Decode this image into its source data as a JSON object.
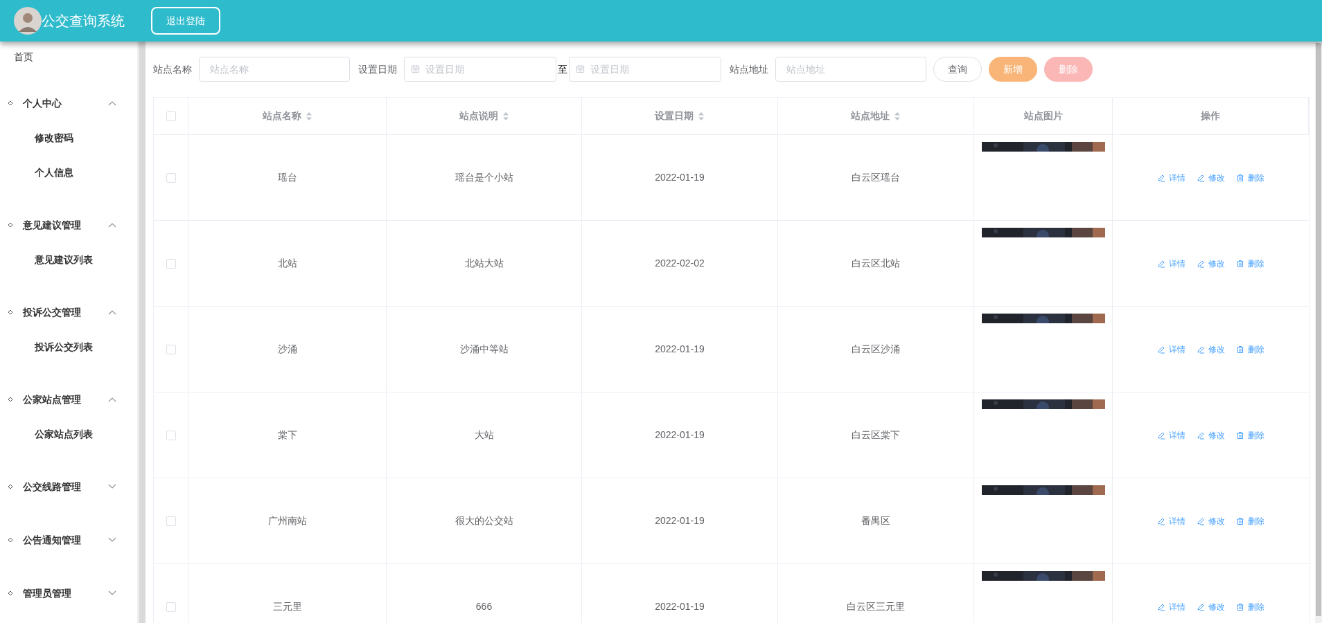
{
  "header": {
    "title": "公交查询系统",
    "logout": "退出登陆"
  },
  "sidebar": {
    "home": "首页",
    "groups": [
      {
        "label": "个人中心",
        "expanded": true,
        "children": [
          {
            "label": "修改密码"
          },
          {
            "label": "个人信息"
          }
        ]
      },
      {
        "label": "意见建议管理",
        "expanded": true,
        "children": [
          {
            "label": "意见建议列表"
          }
        ]
      },
      {
        "label": "投诉公交管理",
        "expanded": true,
        "children": [
          {
            "label": "投诉公交列表"
          }
        ]
      },
      {
        "label": "公家站点管理",
        "expanded": true,
        "children": [
          {
            "label": "公家站点列表"
          }
        ]
      },
      {
        "label": "公交线路管理",
        "expanded": false
      },
      {
        "label": "公告通知管理",
        "expanded": false
      },
      {
        "label": "管理员管理",
        "expanded": false
      }
    ]
  },
  "filters": {
    "name": {
      "label": "站点名称",
      "placeholder": "站点名称"
    },
    "date": {
      "label": "设置日期",
      "from_placeholder": "设置日期",
      "separator": "至",
      "to_placeholder": "设置日期"
    },
    "address": {
      "label": "站点地址",
      "placeholder": "站点地址"
    },
    "buttons": [
      {
        "label": "查询",
        "kind": "plain"
      },
      {
        "label": "新增",
        "kind": "add"
      },
      {
        "label": "删除",
        "kind": "delete"
      }
    ]
  },
  "table": {
    "select_all_checked": false,
    "columns": [
      {
        "label": "站点名称",
        "sortable": true
      },
      {
        "label": "站点说明",
        "sortable": true
      },
      {
        "label": "设置日期",
        "sortable": true
      },
      {
        "label": "站点地址",
        "sortable": true
      },
      {
        "label": "站点图片",
        "sortable": false
      },
      {
        "label": "操作",
        "sortable": false
      }
    ],
    "rows": [
      {
        "checked": false,
        "name": "瑶台",
        "description": "瑶台是个小站",
        "date": "2022-01-19",
        "address": "白云区瑶台",
        "actions": [
          {
            "label": "详情",
            "kind": "edit"
          },
          {
            "label": "修改",
            "kind": "edit"
          },
          {
            "label": "删除",
            "kind": "delete"
          }
        ]
      },
      {
        "checked": false,
        "name": "北站",
        "description": "北站大站",
        "date": "2022-02-02",
        "address": "白云区北站",
        "actions": [
          {
            "label": "详情",
            "kind": "edit"
          },
          {
            "label": "修改",
            "kind": "edit"
          },
          {
            "label": "删除",
            "kind": "delete"
          }
        ]
      },
      {
        "checked": false,
        "name": "沙涌",
        "description": "沙涌中等站",
        "date": "2022-01-19",
        "address": "白云区沙涌",
        "actions": [
          {
            "label": "详情",
            "kind": "edit"
          },
          {
            "label": "修改",
            "kind": "edit"
          },
          {
            "label": "删除",
            "kind": "delete"
          }
        ]
      },
      {
        "checked": false,
        "name": "棠下",
        "description": "大站",
        "date": "2022-01-19",
        "address": "白云区棠下",
        "actions": [
          {
            "label": "详情",
            "kind": "edit"
          },
          {
            "label": "修改",
            "kind": "edit"
          },
          {
            "label": "删除",
            "kind": "delete"
          }
        ]
      },
      {
        "checked": false,
        "name": "广州南站",
        "description": "很大的公交站",
        "date": "2022-01-19",
        "address": "番禺区",
        "actions": [
          {
            "label": "详情",
            "kind": "edit"
          },
          {
            "label": "修改",
            "kind": "edit"
          },
          {
            "label": "删除",
            "kind": "delete"
          }
        ]
      },
      {
        "checked": false,
        "name": "三元里",
        "description": "666",
        "date": "2022-01-19",
        "address": "白云区三元里",
        "actions": [
          {
            "label": "详情",
            "kind": "edit"
          },
          {
            "label": "修改",
            "kind": "edit"
          },
          {
            "label": "删除",
            "kind": "delete"
          }
        ]
      }
    ]
  }
}
